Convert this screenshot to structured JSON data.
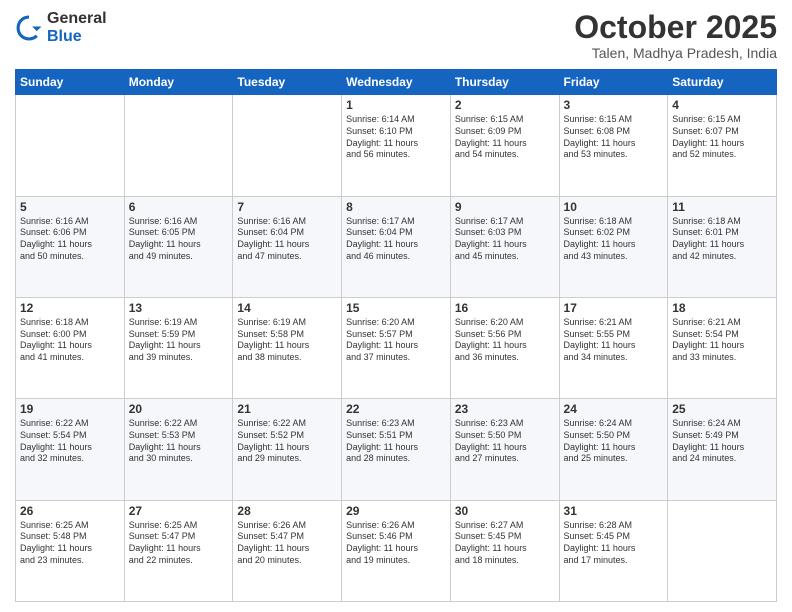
{
  "logo": {
    "general": "General",
    "blue": "Blue"
  },
  "header": {
    "month": "October 2025",
    "location": "Talen, Madhya Pradesh, India"
  },
  "weekdays": [
    "Sunday",
    "Monday",
    "Tuesday",
    "Wednesday",
    "Thursday",
    "Friday",
    "Saturday"
  ],
  "weeks": [
    [
      {
        "day": "",
        "info": ""
      },
      {
        "day": "",
        "info": ""
      },
      {
        "day": "",
        "info": ""
      },
      {
        "day": "1",
        "info": "Sunrise: 6:14 AM\nSunset: 6:10 PM\nDaylight: 11 hours\nand 56 minutes."
      },
      {
        "day": "2",
        "info": "Sunrise: 6:15 AM\nSunset: 6:09 PM\nDaylight: 11 hours\nand 54 minutes."
      },
      {
        "day": "3",
        "info": "Sunrise: 6:15 AM\nSunset: 6:08 PM\nDaylight: 11 hours\nand 53 minutes."
      },
      {
        "day": "4",
        "info": "Sunrise: 6:15 AM\nSunset: 6:07 PM\nDaylight: 11 hours\nand 52 minutes."
      }
    ],
    [
      {
        "day": "5",
        "info": "Sunrise: 6:16 AM\nSunset: 6:06 PM\nDaylight: 11 hours\nand 50 minutes."
      },
      {
        "day": "6",
        "info": "Sunrise: 6:16 AM\nSunset: 6:05 PM\nDaylight: 11 hours\nand 49 minutes."
      },
      {
        "day": "7",
        "info": "Sunrise: 6:16 AM\nSunset: 6:04 PM\nDaylight: 11 hours\nand 47 minutes."
      },
      {
        "day": "8",
        "info": "Sunrise: 6:17 AM\nSunset: 6:04 PM\nDaylight: 11 hours\nand 46 minutes."
      },
      {
        "day": "9",
        "info": "Sunrise: 6:17 AM\nSunset: 6:03 PM\nDaylight: 11 hours\nand 45 minutes."
      },
      {
        "day": "10",
        "info": "Sunrise: 6:18 AM\nSunset: 6:02 PM\nDaylight: 11 hours\nand 43 minutes."
      },
      {
        "day": "11",
        "info": "Sunrise: 6:18 AM\nSunset: 6:01 PM\nDaylight: 11 hours\nand 42 minutes."
      }
    ],
    [
      {
        "day": "12",
        "info": "Sunrise: 6:18 AM\nSunset: 6:00 PM\nDaylight: 11 hours\nand 41 minutes."
      },
      {
        "day": "13",
        "info": "Sunrise: 6:19 AM\nSunset: 5:59 PM\nDaylight: 11 hours\nand 39 minutes."
      },
      {
        "day": "14",
        "info": "Sunrise: 6:19 AM\nSunset: 5:58 PM\nDaylight: 11 hours\nand 38 minutes."
      },
      {
        "day": "15",
        "info": "Sunrise: 6:20 AM\nSunset: 5:57 PM\nDaylight: 11 hours\nand 37 minutes."
      },
      {
        "day": "16",
        "info": "Sunrise: 6:20 AM\nSunset: 5:56 PM\nDaylight: 11 hours\nand 36 minutes."
      },
      {
        "day": "17",
        "info": "Sunrise: 6:21 AM\nSunset: 5:55 PM\nDaylight: 11 hours\nand 34 minutes."
      },
      {
        "day": "18",
        "info": "Sunrise: 6:21 AM\nSunset: 5:54 PM\nDaylight: 11 hours\nand 33 minutes."
      }
    ],
    [
      {
        "day": "19",
        "info": "Sunrise: 6:22 AM\nSunset: 5:54 PM\nDaylight: 11 hours\nand 32 minutes."
      },
      {
        "day": "20",
        "info": "Sunrise: 6:22 AM\nSunset: 5:53 PM\nDaylight: 11 hours\nand 30 minutes."
      },
      {
        "day": "21",
        "info": "Sunrise: 6:22 AM\nSunset: 5:52 PM\nDaylight: 11 hours\nand 29 minutes."
      },
      {
        "day": "22",
        "info": "Sunrise: 6:23 AM\nSunset: 5:51 PM\nDaylight: 11 hours\nand 28 minutes."
      },
      {
        "day": "23",
        "info": "Sunrise: 6:23 AM\nSunset: 5:50 PM\nDaylight: 11 hours\nand 27 minutes."
      },
      {
        "day": "24",
        "info": "Sunrise: 6:24 AM\nSunset: 5:50 PM\nDaylight: 11 hours\nand 25 minutes."
      },
      {
        "day": "25",
        "info": "Sunrise: 6:24 AM\nSunset: 5:49 PM\nDaylight: 11 hours\nand 24 minutes."
      }
    ],
    [
      {
        "day": "26",
        "info": "Sunrise: 6:25 AM\nSunset: 5:48 PM\nDaylight: 11 hours\nand 23 minutes."
      },
      {
        "day": "27",
        "info": "Sunrise: 6:25 AM\nSunset: 5:47 PM\nDaylight: 11 hours\nand 22 minutes."
      },
      {
        "day": "28",
        "info": "Sunrise: 6:26 AM\nSunset: 5:47 PM\nDaylight: 11 hours\nand 20 minutes."
      },
      {
        "day": "29",
        "info": "Sunrise: 6:26 AM\nSunset: 5:46 PM\nDaylight: 11 hours\nand 19 minutes."
      },
      {
        "day": "30",
        "info": "Sunrise: 6:27 AM\nSunset: 5:45 PM\nDaylight: 11 hours\nand 18 minutes."
      },
      {
        "day": "31",
        "info": "Sunrise: 6:28 AM\nSunset: 5:45 PM\nDaylight: 11 hours\nand 17 minutes."
      },
      {
        "day": "",
        "info": ""
      }
    ]
  ]
}
